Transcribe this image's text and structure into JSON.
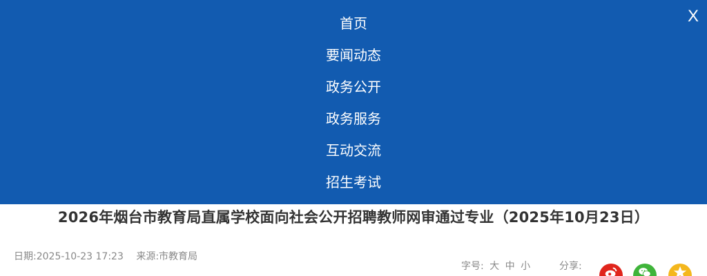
{
  "nav_menu": {
    "items": [
      "首页",
      "要闻动态",
      "政务公开",
      "政务服务",
      "互动交流",
      "招生考试"
    ],
    "close_label": "X"
  },
  "article": {
    "title": "2026年烟台市教育局直属学校面向社会公开招聘教师网审通过专业（2025年10月23日）",
    "date": "日期:2025-10-23 17:23",
    "source": "来源:市教育局"
  },
  "font_size": {
    "label": "字号:",
    "large": "大",
    "medium": "中",
    "small": "小"
  },
  "share": {
    "label": "分享:",
    "icons": [
      "weibo-icon",
      "wechat-icon",
      "qzone-icon"
    ]
  },
  "colors": {
    "nav_bg": "#125bb0",
    "weibo": "#e0251c",
    "wechat": "#3fb43a",
    "qzone": "#f4b71d"
  }
}
